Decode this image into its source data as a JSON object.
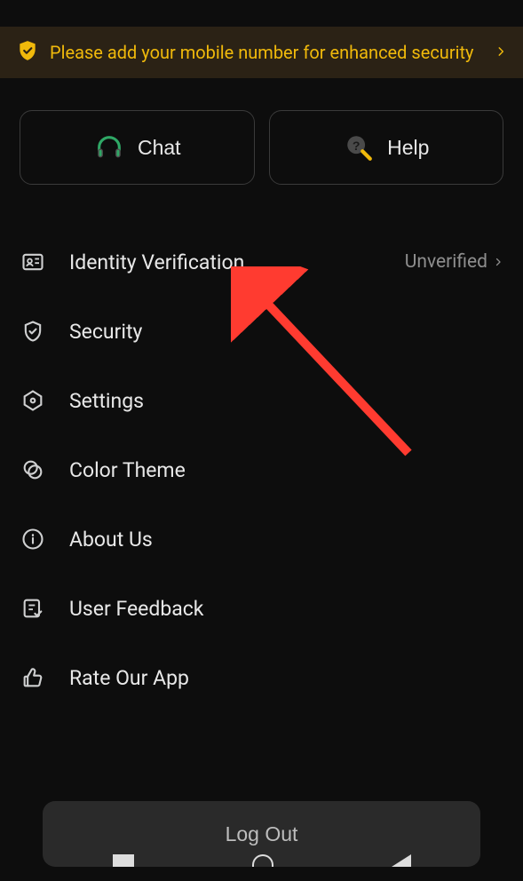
{
  "banner": {
    "text": "Please add your mobile number for enhanced security"
  },
  "actions": {
    "chat_label": "Chat",
    "help_label": "Help"
  },
  "menu": {
    "identity": {
      "label": "Identity Verification",
      "status": "Unverified"
    },
    "security": {
      "label": "Security"
    },
    "settings": {
      "label": "Settings"
    },
    "color_theme": {
      "label": "Color Theme"
    },
    "about": {
      "label": "About Us"
    },
    "feedback": {
      "label": "User Feedback"
    },
    "rate": {
      "label": "Rate Our App"
    }
  },
  "logout_label": "Log Out",
  "colors": {
    "accent": "#f0b90b",
    "bg": "#0d0d0d",
    "banner_bg": "#2b2215",
    "arrow": "#ff3b30"
  },
  "annotation": {
    "type": "arrow",
    "target": "identity-verification-item"
  }
}
